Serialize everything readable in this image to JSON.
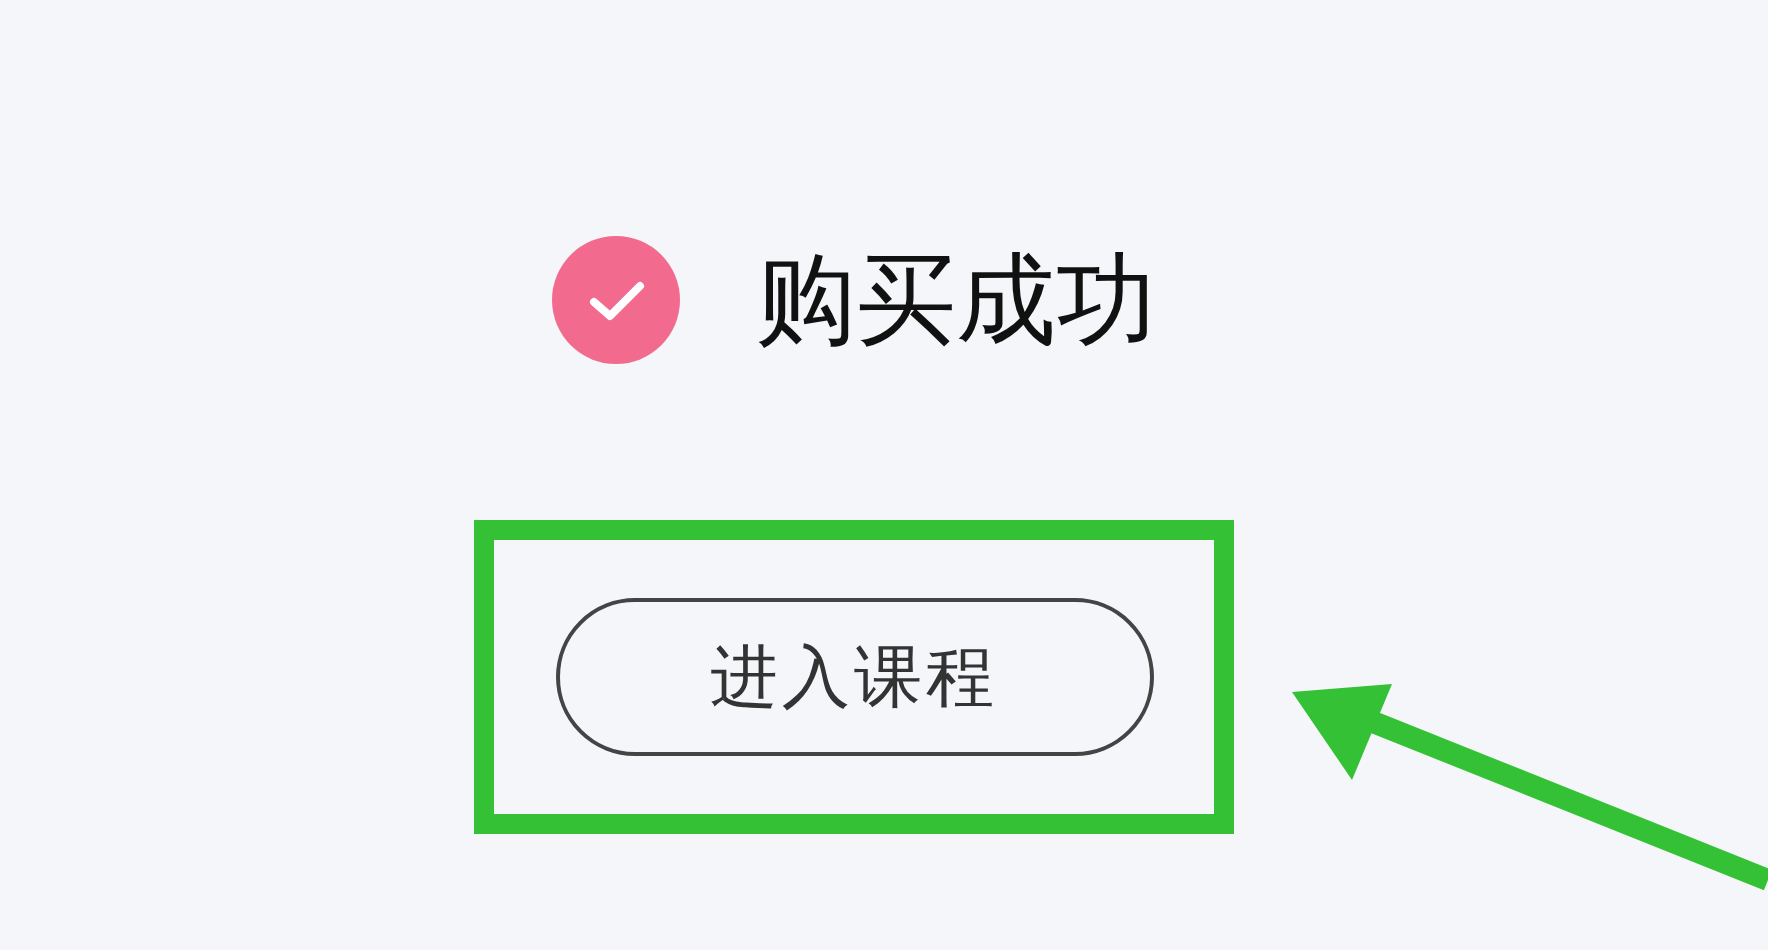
{
  "status": {
    "kind": "success",
    "title": "购买成功"
  },
  "enter_button": {
    "label": "进入课程"
  },
  "highlight_frame": {
    "color": "#35c135"
  },
  "pointer_arrow": {
    "color": "#35c135"
  }
}
